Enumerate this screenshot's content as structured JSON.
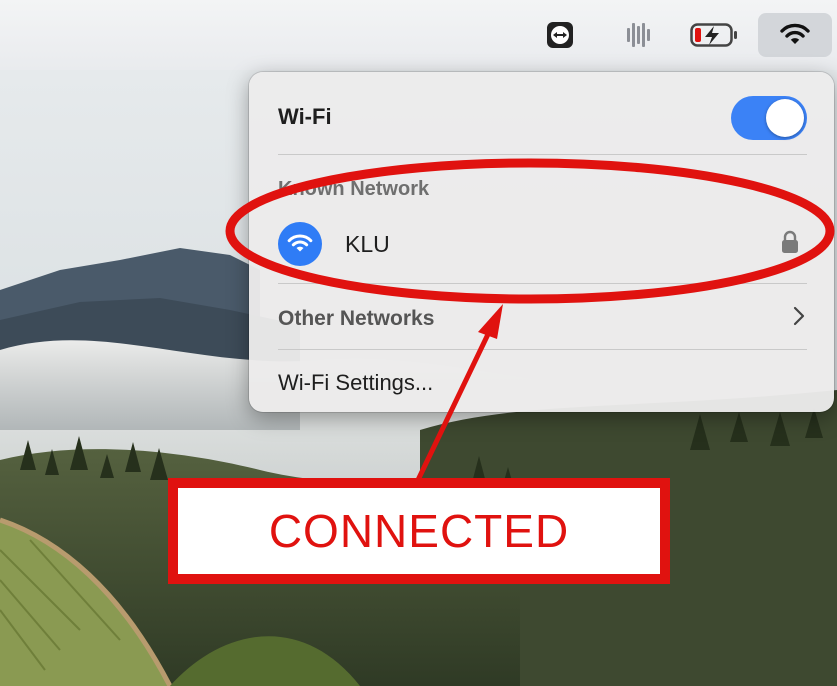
{
  "menubar": {
    "icons": [
      "teamviewer-icon",
      "audio-meter-icon",
      "battery-charging-icon",
      "wifi-icon"
    ]
  },
  "wifi_menu": {
    "title": "Wi-Fi",
    "toggle_on": true,
    "known_network_label": "Known Network",
    "known_network": {
      "name": "KLU",
      "secured": true
    },
    "other_networks_label": "Other Networks",
    "settings_label": "Wi-Fi Settings..."
  },
  "annotation": {
    "callout_text": "CONNECTED",
    "color": "#e0120f"
  },
  "colors": {
    "accent": "#3b82f6",
    "network_icon": "#2f7cf6",
    "battery_low": "#e0120f"
  }
}
